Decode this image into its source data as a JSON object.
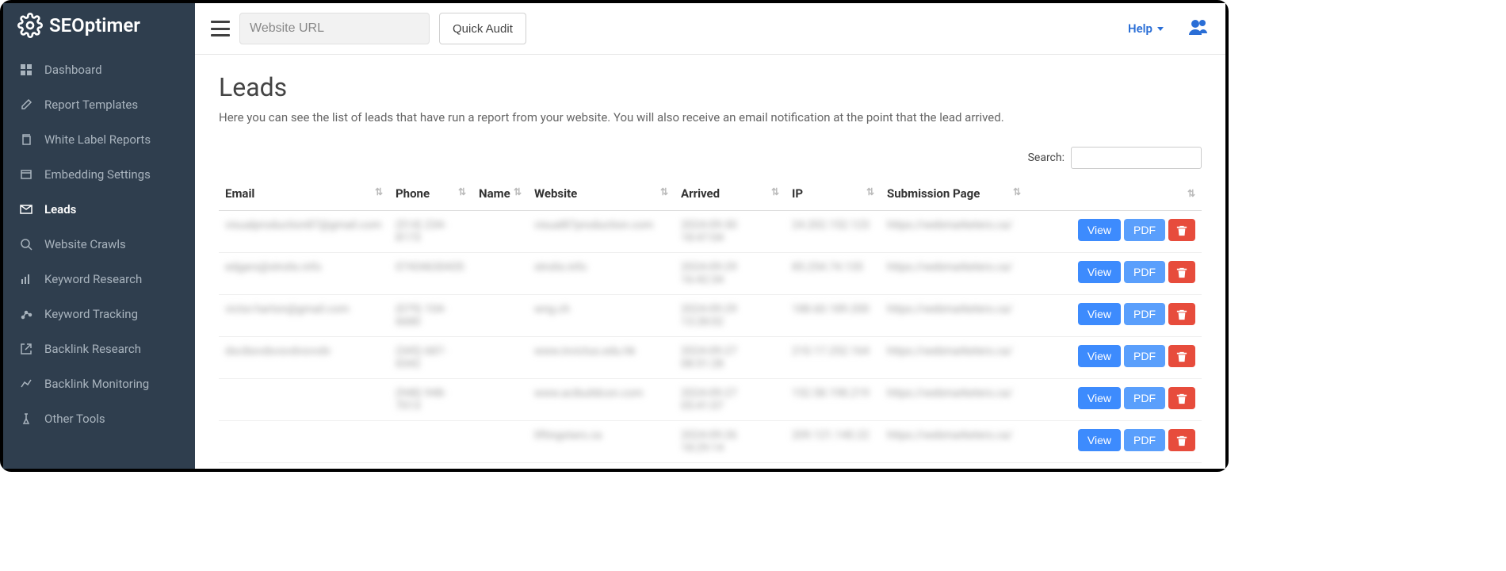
{
  "brand": "SEOptimer",
  "sidebar": {
    "items": [
      {
        "label": "Dashboard",
        "icon": "dashboard-icon"
      },
      {
        "label": "Report Templates",
        "icon": "edit-icon"
      },
      {
        "label": "White Label Reports",
        "icon": "copy-icon"
      },
      {
        "label": "Embedding Settings",
        "icon": "embed-icon"
      },
      {
        "label": "Leads",
        "icon": "mail-icon",
        "active": true
      },
      {
        "label": "Website Crawls",
        "icon": "search-icon"
      },
      {
        "label": "Keyword Research",
        "icon": "bars-icon"
      },
      {
        "label": "Keyword Tracking",
        "icon": "tracking-icon"
      },
      {
        "label": "Backlink Research",
        "icon": "external-icon"
      },
      {
        "label": "Backlink Monitoring",
        "icon": "chart-icon"
      },
      {
        "label": "Other Tools",
        "icon": "tools-icon"
      }
    ]
  },
  "topbar": {
    "url_placeholder": "Website URL",
    "audit_label": "Quick Audit",
    "help_label": "Help"
  },
  "page": {
    "title": "Leads",
    "subtitle": "Here you can see the list of leads that have run a report from your website. You will also receive an email notification at the point that the lead arrived.",
    "search_label": "Search:"
  },
  "table": {
    "columns": [
      "Email",
      "Phone",
      "Name",
      "Website",
      "Arrived",
      "IP",
      "Submission Page"
    ],
    "actions": {
      "view": "View",
      "pdf": "PDF"
    },
    "rows": [
      {
        "email": "visualproduction87@gmail.com",
        "phone": "(514) 234-8173",
        "name": "",
        "website": "visual87production.com",
        "arrived": "2024-09-30 18:47:04",
        "ip": "24.202.152.123",
        "page": "https://webmarketers.ca/"
      },
      {
        "email": "edgars@strolis.info",
        "phone": "07434630435",
        "name": "",
        "website": "strolis.info",
        "arrived": "2024-09-29 16:42:34",
        "ip": "85.254.74.135",
        "page": "https://webmarketers.ca/"
      },
      {
        "email": "victor.harton@gmail.com",
        "phone": "(079) 104-6680",
        "name": "",
        "website": "wng.ch",
        "arrived": "2024-09-29 13:28:02",
        "ip": "188.60.189.200",
        "page": "https://webmarketers.ca/"
      },
      {
        "email": "dscibxvdsvsvdvsvvdv",
        "phone": "(345) 687-6542",
        "name": "",
        "website": "www.invictus.edu.hk",
        "arrived": "2024-09-27 08:51:28",
        "ip": "210.17.252.164",
        "page": "https://webmarketers.ca/"
      },
      {
        "email": "",
        "phone": "(948) 948-7013",
        "name": "",
        "website": "www.acibuildcon.com",
        "arrived": "2024-09-27 05:41:07",
        "ip": "152.58.198.219",
        "page": "https://webmarketers.ca/"
      },
      {
        "email": "",
        "phone": "",
        "name": "",
        "website": "liftingstars.ca",
        "arrived": "2024-09-26 18:29:14",
        "ip": "209.121.140.22",
        "page": "https://webmarketers.ca/"
      }
    ]
  }
}
